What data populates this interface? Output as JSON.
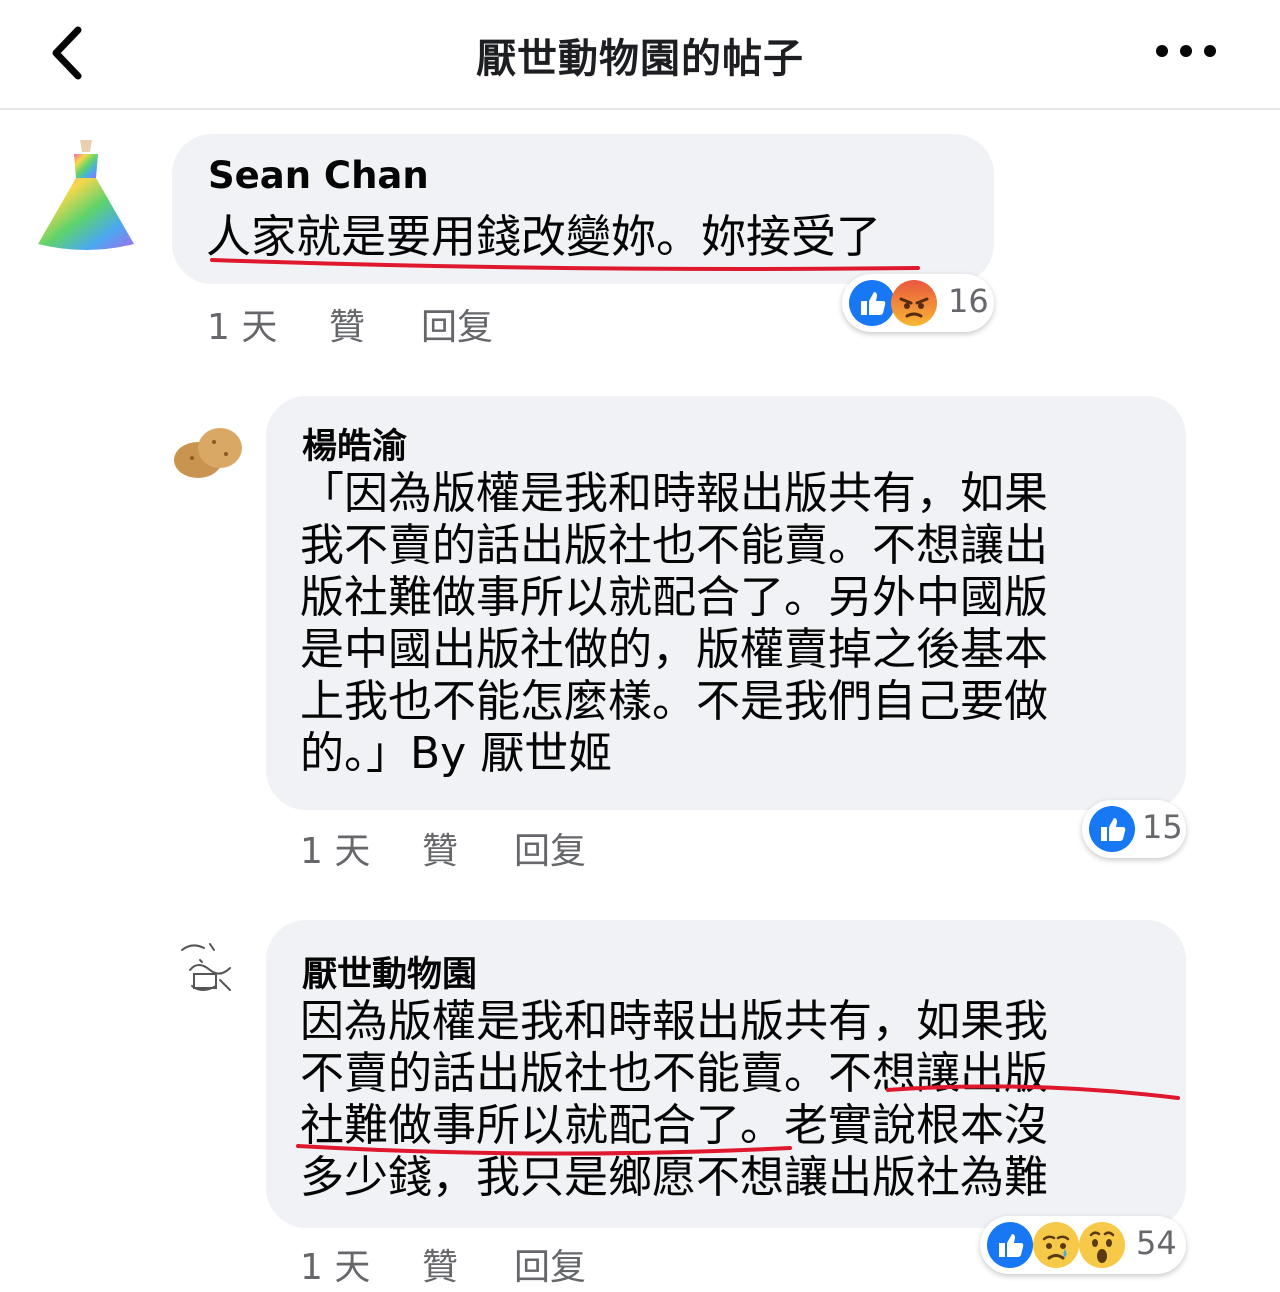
{
  "header": {
    "title": "厭世動物園的帖子",
    "back_icon": "chevron-left-icon",
    "more_icon": "ellipsis-icon"
  },
  "colors": {
    "bubble": "#f0f2f5",
    "like_blue": "#1877f2",
    "annotation_red": "#e0182e",
    "meta_gray": "#65676b"
  },
  "comments": [
    {
      "author": "Sean Chan",
      "lines": [
        "人家就是要用錢改變妳。妳接受了"
      ],
      "time": "1 天",
      "like": "贊",
      "reply": "回复",
      "reactions": [
        "like-icon",
        "angry-icon"
      ],
      "reaction_count": "16"
    },
    {
      "author": "楊皓渝",
      "lines": [
        "「因為版權是我和時報出版共有，如果",
        "我不賣的話出版社也不能賣。不想讓出",
        "版社難做事所以就配合了。另外中國版",
        "是中國出版社做的，版權賣掉之後基本",
        "上我也不能怎麼樣。不是我們自己要做",
        "的。」By 厭世姬"
      ],
      "time": "1 天",
      "like": "贊",
      "reply": "回复",
      "reactions": [
        "like-icon"
      ],
      "reaction_count": "15"
    },
    {
      "author": "厭世動物園",
      "lines": [
        "因為版權是我和時報出版共有，如果我",
        "不賣的話出版社也不能賣。不想讓出版",
        "社難做事所以就配合了。老實說根本沒",
        "多少錢，我只是鄉愿不想讓出版社為難"
      ],
      "time": "1 天",
      "like": "贊",
      "reply": "回复",
      "reactions": [
        "like-icon",
        "sad-icon",
        "wow-icon"
      ],
      "reaction_count": "54"
    }
  ]
}
